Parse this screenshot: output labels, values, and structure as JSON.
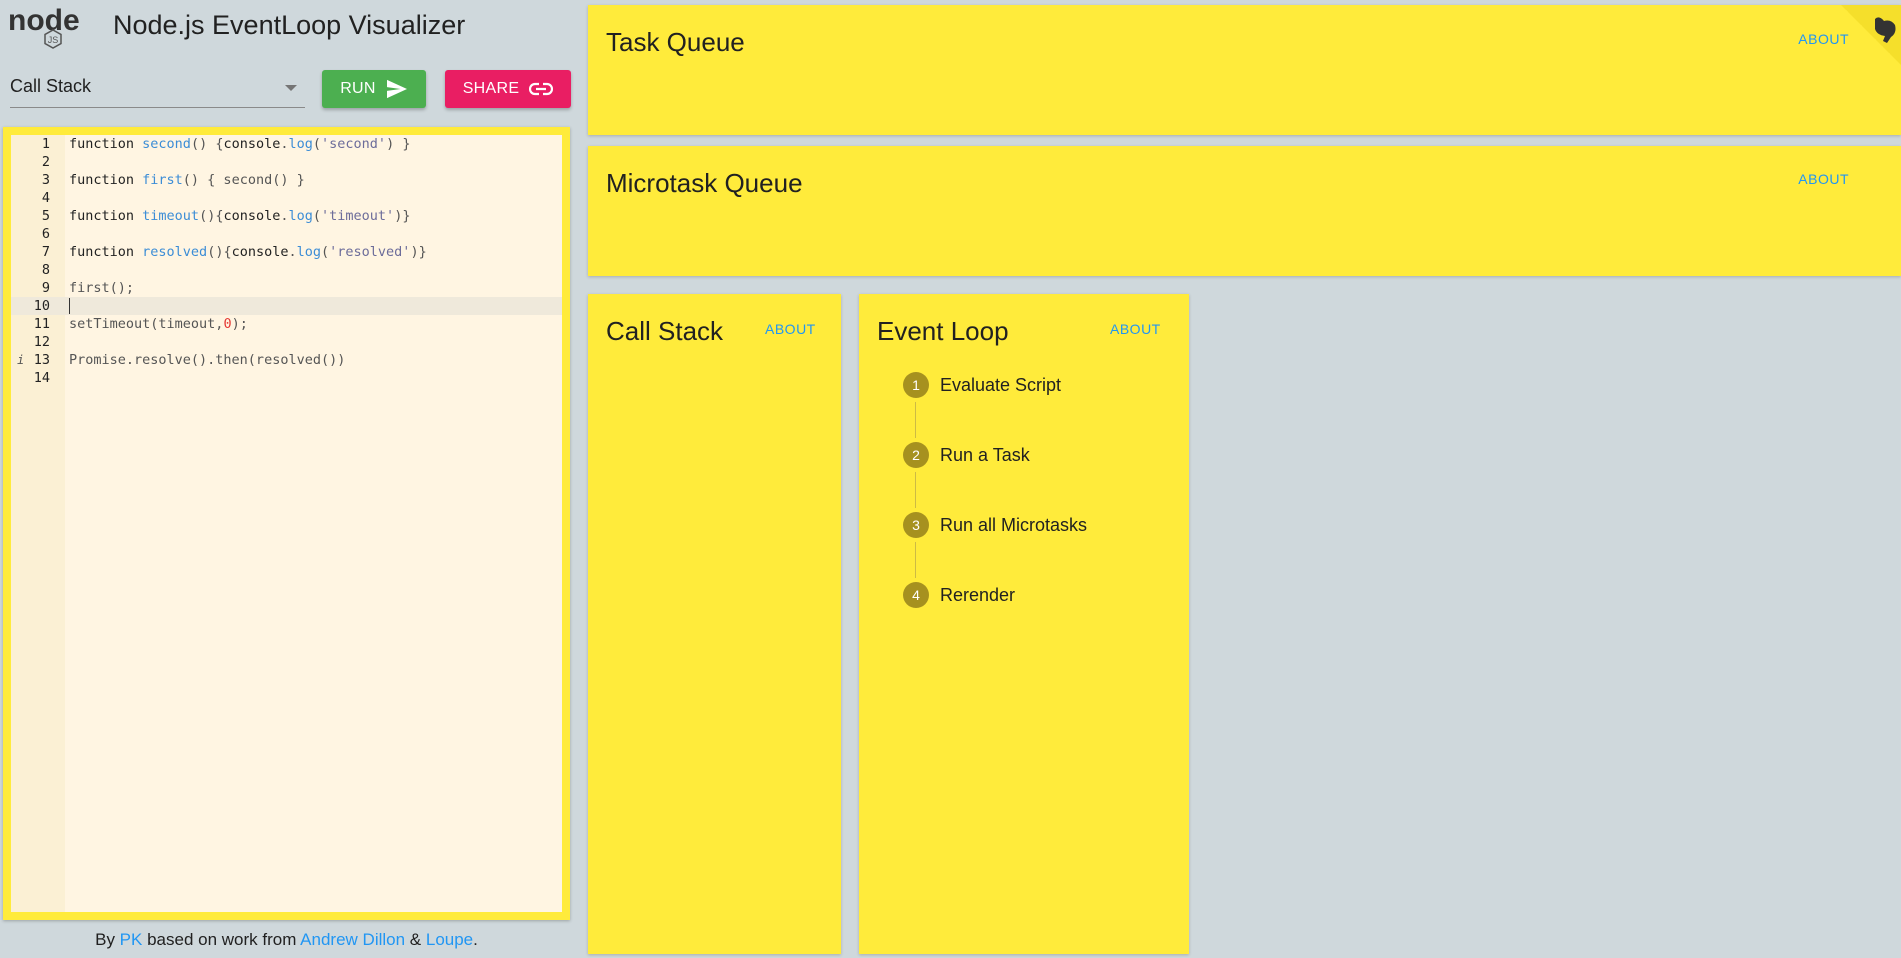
{
  "header": {
    "logo_text": "node",
    "logo_badge": "JS",
    "title": "Node.js EventLoop Visualizer"
  },
  "controls": {
    "select_value": "Call Stack",
    "run_label": "RUN",
    "share_label": "SHARE"
  },
  "editor": {
    "lines": [
      {
        "n": "1",
        "tokens": [
          [
            "kw",
            "function "
          ],
          [
            "fn",
            "second"
          ],
          [
            "plain",
            "() {"
          ],
          [
            "kw",
            "console"
          ],
          [
            "plain",
            "."
          ],
          [
            "fn",
            "log"
          ],
          [
            "plain",
            "("
          ],
          [
            "str",
            "'second'"
          ],
          [
            "plain",
            ") }"
          ]
        ]
      },
      {
        "n": "2",
        "tokens": []
      },
      {
        "n": "3",
        "tokens": [
          [
            "kw",
            "function "
          ],
          [
            "fn",
            "first"
          ],
          [
            "plain",
            "() { second() }"
          ]
        ]
      },
      {
        "n": "4",
        "tokens": []
      },
      {
        "n": "5",
        "tokens": [
          [
            "kw",
            "function "
          ],
          [
            "fn",
            "timeout"
          ],
          [
            "plain",
            "(){"
          ],
          [
            "kw",
            "console"
          ],
          [
            "plain",
            "."
          ],
          [
            "fn",
            "log"
          ],
          [
            "plain",
            "("
          ],
          [
            "str",
            "'timeout'"
          ],
          [
            "plain",
            ")}"
          ]
        ]
      },
      {
        "n": "6",
        "tokens": []
      },
      {
        "n": "7",
        "tokens": [
          [
            "kw",
            "function "
          ],
          [
            "fn",
            "resolved"
          ],
          [
            "plain",
            "(){"
          ],
          [
            "kw",
            "console"
          ],
          [
            "plain",
            "."
          ],
          [
            "fn",
            "log"
          ],
          [
            "plain",
            "("
          ],
          [
            "str",
            "'resolved'"
          ],
          [
            "plain",
            ")}"
          ]
        ]
      },
      {
        "n": "8",
        "tokens": []
      },
      {
        "n": "9",
        "tokens": [
          [
            "plain",
            "first();"
          ]
        ]
      },
      {
        "n": "10",
        "tokens": [],
        "active": true
      },
      {
        "n": "11",
        "tokens": [
          [
            "plain",
            "setTimeout(timeout,"
          ],
          [
            "num",
            "0"
          ],
          [
            "plain",
            ");"
          ]
        ]
      },
      {
        "n": "12",
        "tokens": []
      },
      {
        "n": "13",
        "tokens": [
          [
            "plain",
            "Promise.resolve().then(resolved())"
          ]
        ],
        "info": "i"
      },
      {
        "n": "14",
        "tokens": []
      }
    ]
  },
  "footer": {
    "by": "By ",
    "pk": "PK",
    "based": " based on work from ",
    "andrew": "Andrew Dillon",
    "amp": " & ",
    "loupe": "Loupe",
    "dot": "."
  },
  "panels": {
    "task_queue": {
      "title": "Task Queue",
      "about": "ABOUT"
    },
    "microtask_queue": {
      "title": "Microtask Queue",
      "about": "ABOUT"
    },
    "call_stack": {
      "title": "Call Stack",
      "about": "ABOUT"
    },
    "event_loop": {
      "title": "Event Loop",
      "about": "ABOUT",
      "steps": [
        {
          "num": "1",
          "label": "Evaluate Script"
        },
        {
          "num": "2",
          "label": "Run a Task"
        },
        {
          "num": "3",
          "label": "Run all Microtasks"
        },
        {
          "num": "4",
          "label": "Rerender"
        }
      ]
    }
  },
  "colors": {
    "panel": "#ffeb3b",
    "run": "#4caf50",
    "share": "#e91e63",
    "link": "#2196f3",
    "step_dot": "#a6911f"
  }
}
